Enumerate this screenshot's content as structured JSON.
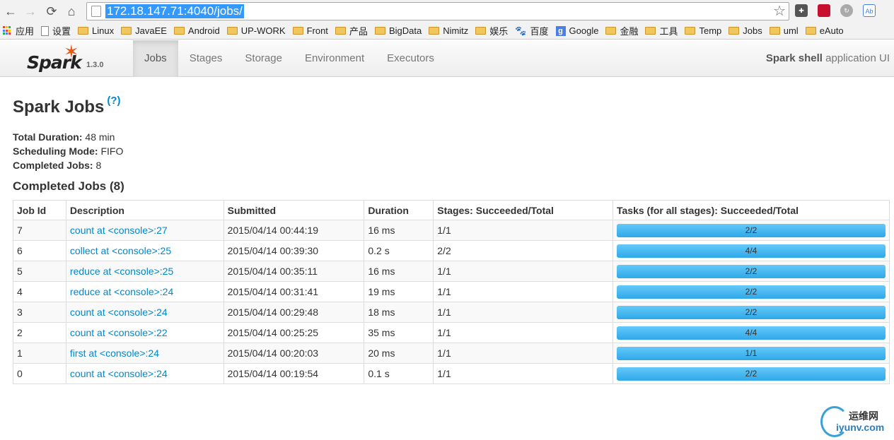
{
  "browser": {
    "url": "172.18.147.71:4040/jobs/",
    "bookmarks": [
      "应用",
      "设置",
      "Linux",
      "JavaEE",
      "Android",
      "UP-WORK",
      "Front",
      "产品",
      "BigData",
      "Nimitz",
      "娱乐",
      "百度",
      "Google",
      "金融",
      "工具",
      "Temp",
      "Jobs",
      "uml",
      "eAuto"
    ]
  },
  "spark": {
    "version": "1.3.0",
    "tabs": [
      "Jobs",
      "Stages",
      "Storage",
      "Environment",
      "Executors"
    ],
    "active_tab": "Jobs",
    "app_name_bold": "Spark shell",
    "app_name_rest": " application UI"
  },
  "page": {
    "title": "Spark Jobs",
    "help": "(?)",
    "total_duration_label": "Total Duration:",
    "total_duration": " 48 min",
    "scheduling_mode_label": "Scheduling Mode:",
    "scheduling_mode": " FIFO",
    "completed_jobs_label": "Completed Jobs:",
    "completed_jobs_count": " 8",
    "section_title": "Completed Jobs (8)"
  },
  "table": {
    "headers": [
      "Job Id",
      "Description",
      "Submitted",
      "Duration",
      "Stages: Succeeded/Total",
      "Tasks (for all stages): Succeeded/Total"
    ],
    "rows": [
      {
        "id": "7",
        "desc": "count at <console>:27",
        "submitted": "2015/04/14 00:44:19",
        "duration": "16 ms",
        "stages": "1/1",
        "tasks": "2/2",
        "tasks_fraction": 1.0
      },
      {
        "id": "6",
        "desc": "collect at <console>:25",
        "submitted": "2015/04/14 00:39:30",
        "duration": "0.2 s",
        "stages": "2/2",
        "tasks": "4/4",
        "tasks_fraction": 1.0
      },
      {
        "id": "5",
        "desc": "reduce at <console>:25",
        "submitted": "2015/04/14 00:35:11",
        "duration": "16 ms",
        "stages": "1/1",
        "tasks": "2/2",
        "tasks_fraction": 1.0
      },
      {
        "id": "4",
        "desc": "reduce at <console>:24",
        "submitted": "2015/04/14 00:31:41",
        "duration": "19 ms",
        "stages": "1/1",
        "tasks": "2/2",
        "tasks_fraction": 1.0
      },
      {
        "id": "3",
        "desc": "count at <console>:24",
        "submitted": "2015/04/14 00:29:48",
        "duration": "18 ms",
        "stages": "1/1",
        "tasks": "2/2",
        "tasks_fraction": 1.0
      },
      {
        "id": "2",
        "desc": "count at <console>:22",
        "submitted": "2015/04/14 00:25:25",
        "duration": "35 ms",
        "stages": "1/1",
        "tasks": "4/4",
        "tasks_fraction": 1.0
      },
      {
        "id": "1",
        "desc": "first at <console>:24",
        "submitted": "2015/04/14 00:20:03",
        "duration": "20 ms",
        "stages": "1/1",
        "tasks": "1/1",
        "tasks_fraction": 1.0
      },
      {
        "id": "0",
        "desc": "count at <console>:24",
        "submitted": "2015/04/14 00:19:54",
        "duration": "0.1 s",
        "stages": "1/1",
        "tasks": "2/2",
        "tasks_fraction": 1.0
      }
    ]
  },
  "watermark": {
    "cn": "运维网",
    "en": "iyunv.com"
  },
  "colors": {
    "link": "#0088cc",
    "progress": "#3eb0ef",
    "spark_orange": "#e25a1c"
  }
}
